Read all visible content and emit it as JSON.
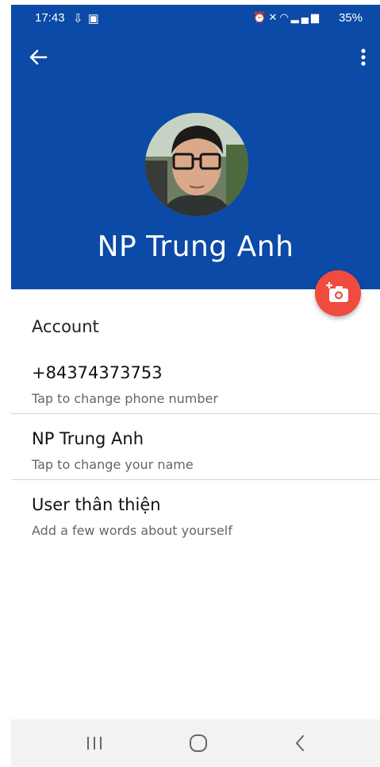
{
  "status_bar": {
    "time": "17:43",
    "left_icons": [
      "cloud-download-icon",
      "image-icon"
    ],
    "right_icons": [
      "alarm-icon",
      "mute-icon",
      "wifi-icon",
      "signal-icon"
    ],
    "battery": "35%"
  },
  "header": {
    "profile_name": "NP Trung Anh",
    "background_color": "#0b4aa6"
  },
  "fab": {
    "icon": "add-photo-icon",
    "color": "#ef4b3f"
  },
  "account": {
    "section_title": "Account",
    "phone": {
      "value": "+84374373753",
      "hint": "Tap to change phone number"
    },
    "name": {
      "value": "NP Trung Anh",
      "hint": "Tap to change your name"
    },
    "bio": {
      "value": "User thân thiện",
      "hint": "Add a few words about yourself"
    }
  },
  "nav_bar": {
    "icons": [
      "recents-icon",
      "home-icon",
      "back-icon"
    ]
  }
}
